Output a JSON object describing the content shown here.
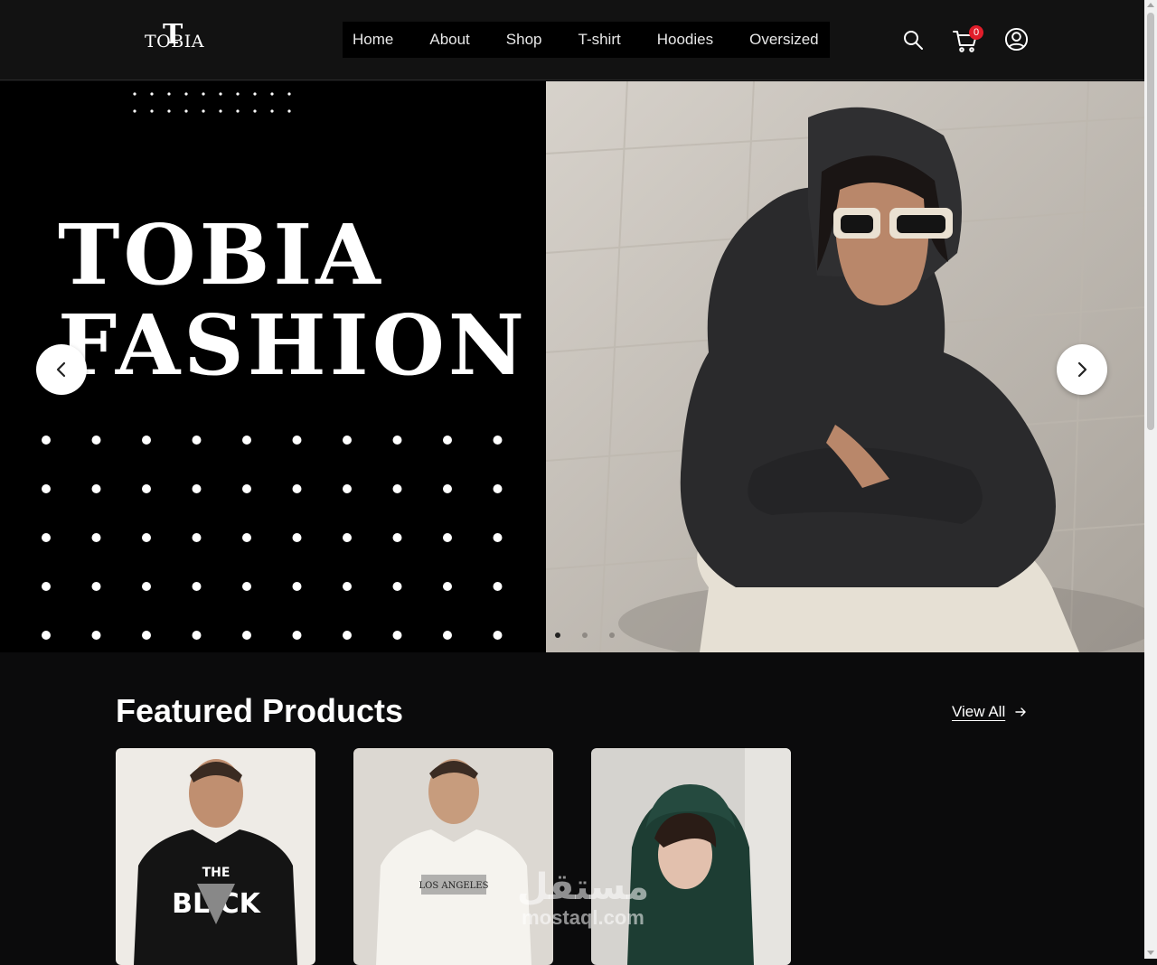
{
  "header": {
    "logo_text": "TOBIA",
    "logo_letter": "T",
    "nav": [
      {
        "label": "Home"
      },
      {
        "label": "About"
      },
      {
        "label": "Shop"
      },
      {
        "label": "T-shirt"
      },
      {
        "label": "Hoodies"
      },
      {
        "label": "Oversized"
      }
    ],
    "icons": {
      "search": "search-icon",
      "cart": "cart-icon",
      "account": "user-icon"
    },
    "cart_count": "0"
  },
  "hero": {
    "title_line1": "TOBIA",
    "title_line2": "FASHION",
    "slide_count": 3,
    "active_slide": 1,
    "image_description": "woman in black hoodie and sunglasses crouching on pavement"
  },
  "featured": {
    "title": "Featured Products",
    "view_all_label": "View All",
    "products": [
      {
        "image": "man in black graphic t-shirt"
      },
      {
        "image": "man in white graphic t-shirt"
      },
      {
        "image": "woman in green hoodie"
      }
    ]
  },
  "watermark": {
    "arabic": "مستقل",
    "latin": "mostaql.com"
  },
  "colors": {
    "background": "#0b0b0c",
    "header": "#121212",
    "badge": "#e11d2a",
    "nav_bg": "#000000"
  }
}
